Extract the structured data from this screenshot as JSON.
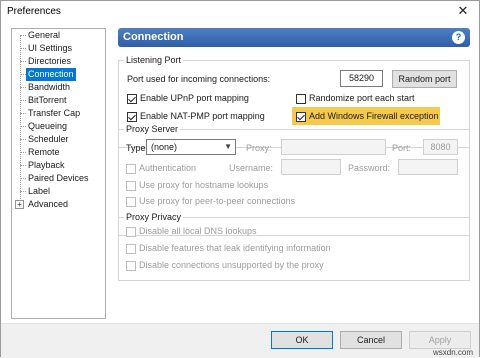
{
  "window": {
    "title": "Preferences",
    "close_glyph": "✕"
  },
  "tree": {
    "items": [
      {
        "label": "General"
      },
      {
        "label": "UI Settings"
      },
      {
        "label": "Directories"
      },
      {
        "label": "Connection",
        "selected": true
      },
      {
        "label": "Bandwidth"
      },
      {
        "label": "BitTorrent"
      },
      {
        "label": "Transfer Cap"
      },
      {
        "label": "Queueing"
      },
      {
        "label": "Scheduler"
      },
      {
        "label": "Remote"
      },
      {
        "label": "Playback"
      },
      {
        "label": "Paired Devices"
      },
      {
        "label": "Label"
      },
      {
        "label": "Advanced",
        "expandable": true
      }
    ],
    "expand_glyph": "+"
  },
  "panel": {
    "title": "Connection",
    "help_glyph": "?",
    "banner_color": "#2f5ea8"
  },
  "listening_port": {
    "group_label": "Listening Port",
    "port_label": "Port used for incoming connections:",
    "port_value": "58290",
    "random_port_button": "Random port",
    "upnp": {
      "label": "Enable UPnP port mapping",
      "checked": true
    },
    "randomize": {
      "label": "Randomize port each start",
      "checked": false
    },
    "natpmp": {
      "label": "Enable NAT-PMP port mapping",
      "checked": true
    },
    "firewall": {
      "label": "Add Windows Firewall exception",
      "checked": true,
      "highlight_color": "#f4c94c"
    }
  },
  "proxy_server": {
    "group_label": "Proxy Server",
    "type_label": "Type:",
    "type_value": "(none)",
    "proxy_label": "Proxy:",
    "port_label": "Port:",
    "port_value": "8080",
    "authentication": {
      "label": "Authentication",
      "checked": false
    },
    "username_label": "Username:",
    "password_label": "Password:",
    "hostname_lookups": {
      "label": "Use proxy for hostname lookups",
      "checked": false
    },
    "p2p": {
      "label": "Use proxy for peer-to-peer connections",
      "checked": false
    }
  },
  "proxy_privacy": {
    "group_label": "Proxy Privacy",
    "dns": {
      "label": "Disable all local DNS lookups",
      "checked": false
    },
    "leak": {
      "label": "Disable features that leak identifying information",
      "checked": false
    },
    "unsupported": {
      "label": "Disable connections unsupported by the proxy",
      "checked": false
    }
  },
  "footer": {
    "ok": "OK",
    "cancel": "Cancel",
    "apply": "Apply"
  },
  "watermark": "wsxdn.com"
}
